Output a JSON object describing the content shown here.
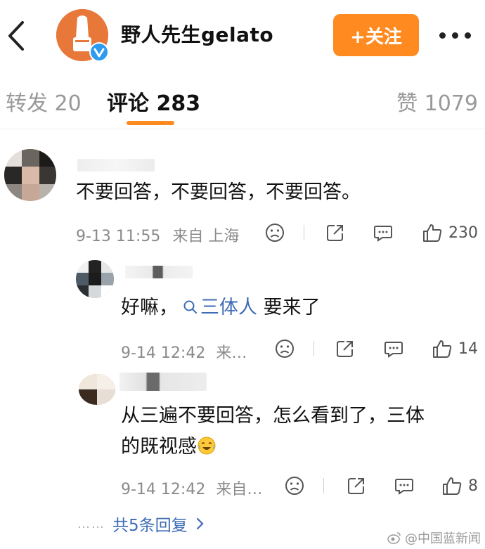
{
  "header": {
    "account_name": "野人先生gelato",
    "follow_label": "+关注",
    "accent_color": "#ff8a1f"
  },
  "tabs": {
    "repost": "转发 20",
    "comments": "评论 283",
    "likes": "赞 1079"
  },
  "comments": [
    {
      "text": "不要回答，不要回答，不要回答。",
      "time": "9-13 11:55",
      "location": "来自 上海",
      "like_count": "230"
    }
  ],
  "replies": [
    {
      "text_before": "好嘛，",
      "topic": "三体人",
      "text_after": " 要来了",
      "time": "9-14 12:42",
      "location": "来…",
      "like_count": "14"
    },
    {
      "line1": "从三遍不要回答，怎么看到了，三体",
      "line2": "的既视感",
      "time": "9-14 12:42",
      "location": "来自…",
      "like_count": "8"
    }
  ],
  "more_replies": "共5条回复",
  "watermark": "@中国蓝新闻",
  "icons": [
    "back-icon",
    "more-icon",
    "dislike-icon",
    "repost-icon",
    "comment-icon",
    "like-icon",
    "search-icon",
    "chevron-right-icon"
  ]
}
